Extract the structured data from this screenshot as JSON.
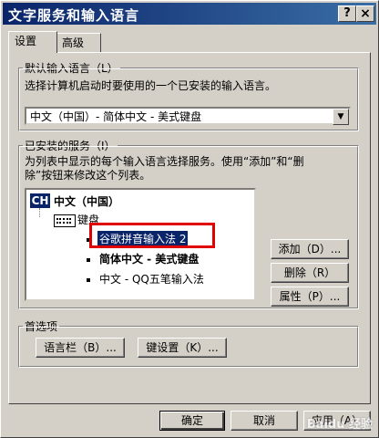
{
  "window": {
    "title": "文字服务和输入语言",
    "help_glyph": "?",
    "close_glyph": "×"
  },
  "tabs": [
    {
      "label": "设置",
      "active": true
    },
    {
      "label": "高级",
      "active": false
    }
  ],
  "default_language": {
    "group_label": "默认输入语言（L）",
    "description": "选择计算机启动时要使用的一个已安装的输入语言。",
    "selected": "中文（中国）- 简体中文 - 美式键盘",
    "dropdown_glyph": "▼"
  },
  "installed_services": {
    "group_label": "已安装的服务（I）",
    "description_line1": "为列表中显示的每个输入语言选择服务。使用“添加”和“删",
    "description_line2": "除”按钮来修改这个列表。",
    "language_badge": "CH",
    "language": "中文（中国）",
    "category": "键盘",
    "items": [
      {
        "label": "谷歌拼音输入法 2",
        "selected": true
      },
      {
        "label": "简体中文 - 美式键盘",
        "selected": false
      },
      {
        "label": "中文 - QQ五笔输入法",
        "selected": false
      }
    ],
    "buttons": {
      "add": "添加（D）...",
      "remove": "删除（R）",
      "properties": "属性（P）..."
    }
  },
  "preferences": {
    "group_label": "首选项",
    "language_bar": "语言栏（B）...",
    "key_settings": "键设置（K）..."
  },
  "footer": {
    "ok": "确定",
    "cancel": "取消",
    "apply": "应用（A）"
  },
  "watermark": "Baidu 经验"
}
